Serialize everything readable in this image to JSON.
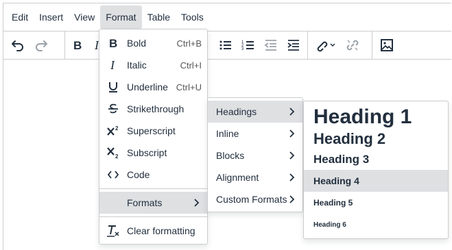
{
  "menubar": {
    "items": [
      "Edit",
      "Insert",
      "View",
      "Format",
      "Table",
      "Tools"
    ],
    "active": "Format"
  },
  "toolbar": {
    "buttons": [
      "undo-icon",
      "redo-icon",
      "bold-icon",
      "italic-icon",
      "bullet-list-icon",
      "numbered-list-icon",
      "outdent-icon",
      "indent-icon",
      "link-icon",
      "unlink-icon",
      "image-icon"
    ]
  },
  "format_menu": {
    "items": [
      {
        "label": "Bold",
        "shortcut": "Ctrl+B",
        "icon": "bold-icon"
      },
      {
        "label": "Italic",
        "shortcut": "Ctrl+I",
        "icon": "italic-icon"
      },
      {
        "label": "Underline",
        "shortcut": "Ctrl+U",
        "icon": "underline-icon"
      },
      {
        "label": "Strikethrough",
        "icon": "strikethrough-icon"
      },
      {
        "label": "Superscript",
        "icon": "superscript-icon"
      },
      {
        "label": "Subscript",
        "icon": "subscript-icon"
      },
      {
        "label": "Code",
        "icon": "code-icon"
      }
    ],
    "formats_label": "Formats",
    "clear_label": "Clear formatting"
  },
  "formats_submenu": {
    "items": [
      "Headings",
      "Inline",
      "Blocks",
      "Alignment",
      "Custom Formats"
    ],
    "highlighted": "Headings"
  },
  "headings_submenu": {
    "items": [
      "Heading 1",
      "Heading 2",
      "Heading 3",
      "Heading 4",
      "Heading 5",
      "Heading 6"
    ],
    "highlighted": "Heading 4"
  },
  "colors": {
    "text": "#222f3e",
    "highlight": "#dee0e2",
    "border": "#cccccc"
  }
}
